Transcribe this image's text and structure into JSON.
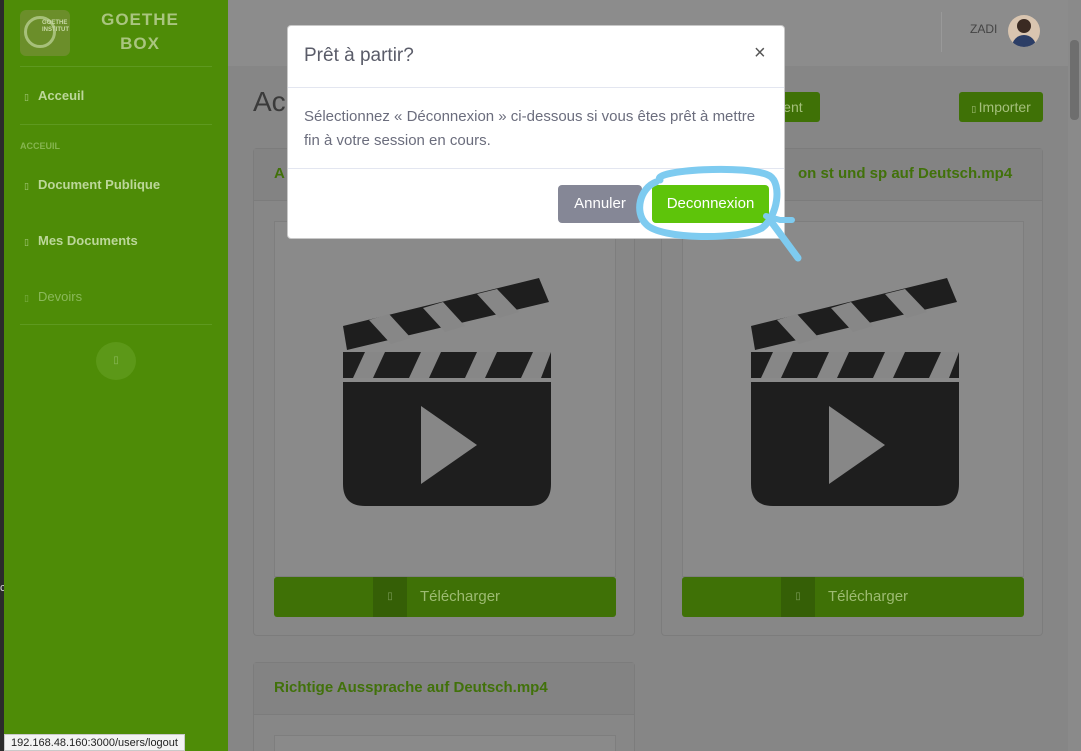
{
  "brand": {
    "name_line1": "GOETHE",
    "name_line2": "BOX",
    "logo_text": "GOETHE INSTITUT"
  },
  "sidebar": {
    "items": [
      {
        "label": "Acceuil",
        "icon": "home-icon"
      },
      {
        "label": "Document Publique",
        "icon": "folder-icon"
      },
      {
        "label": "Mes Documents",
        "icon": "file-icon"
      },
      {
        "label": "Devoirs",
        "icon": "task-icon"
      }
    ],
    "heading": "ACCEUIL",
    "toggle_icon": "chevron-left-icon"
  },
  "topbar": {
    "user_name": "ZADI"
  },
  "page": {
    "title": "Ac",
    "student_button": "dent",
    "import_button": "Importer"
  },
  "cards": [
    {
      "title": "A",
      "download_label": "Télécharger"
    },
    {
      "title": "on st und sp auf Deutsch.mp4",
      "download_label": "Télécharger"
    },
    {
      "title": "Richtige Aussprache auf Deutsch.mp4"
    }
  ],
  "modal": {
    "title": "Prêt à partir?",
    "close_glyph": "×",
    "body": "Sélectionnez « Déconnexion » ci-dessous si vous êtes prêt à mettre fin à votre session en cours.",
    "cancel_label": "Annuler",
    "logout_label": "Deconnexion"
  },
  "status_bar": {
    "url": "192.168.48.160:3000/users/logout"
  },
  "left_edge_char": "c",
  "colors": {
    "sidebar": "#4e8c07",
    "accent_green": "#5ec40a",
    "cancel_gray": "#858796",
    "highlight_blue": "#7ecbf0"
  }
}
